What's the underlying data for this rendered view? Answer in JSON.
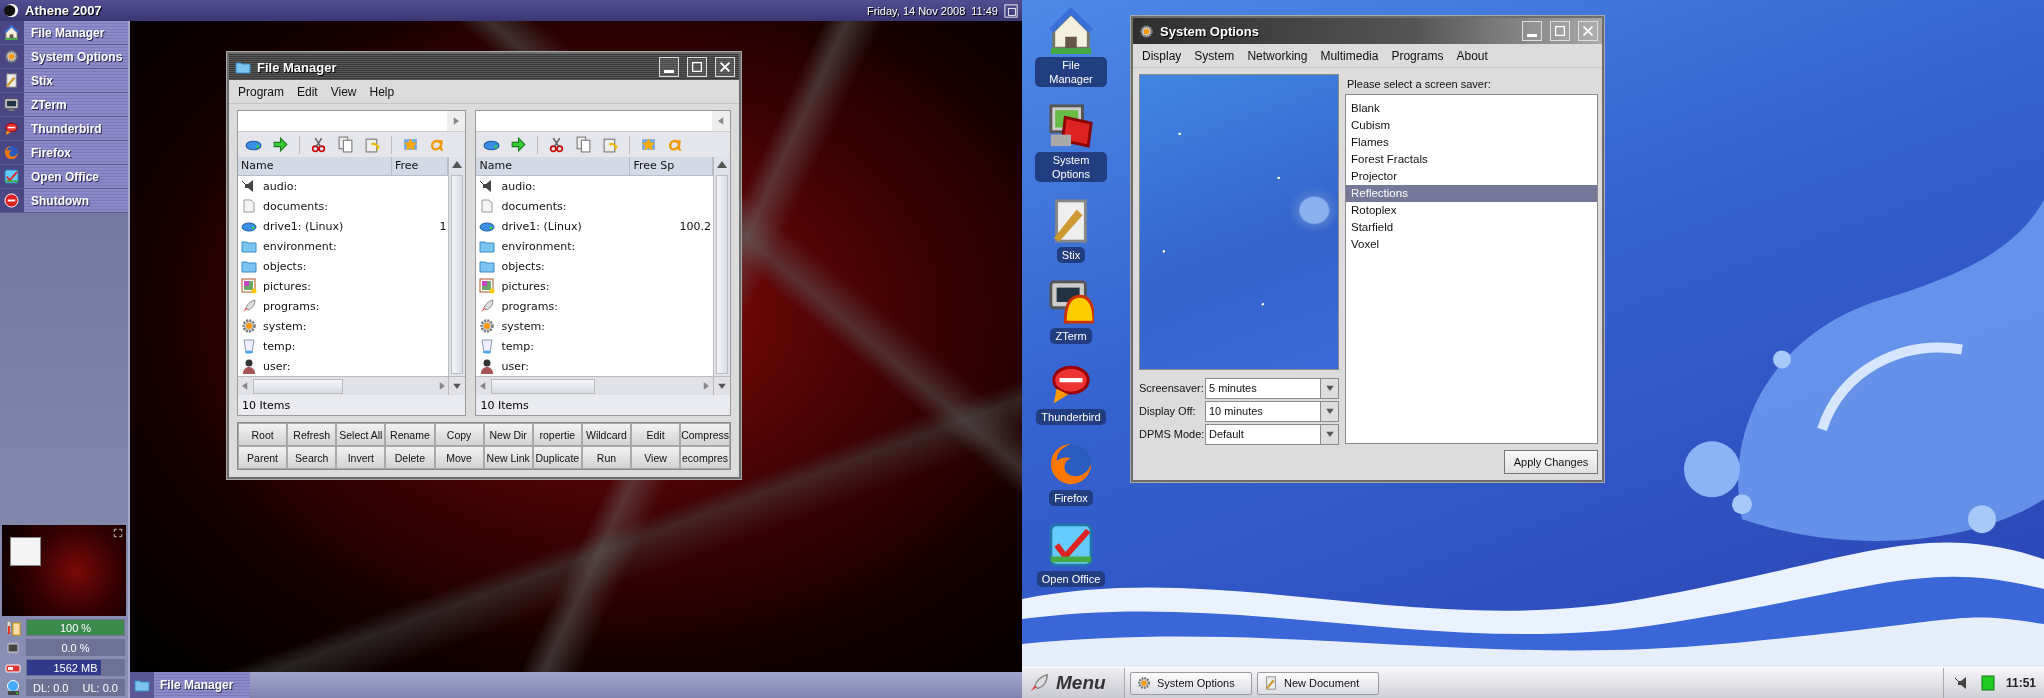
{
  "left_screen": {
    "top_bar": {
      "title": "Athene 2007",
      "date": "Friday, 14 Nov 2008",
      "time": "11:49"
    },
    "sidebar": {
      "items": [
        {
          "label": "File Manager"
        },
        {
          "label": "System Options"
        },
        {
          "label": "Stix"
        },
        {
          "label": "ZTerm"
        },
        {
          "label": "Thunderbird"
        },
        {
          "label": "Firefox"
        },
        {
          "label": "Open Office"
        },
        {
          "label": "Shutdown"
        }
      ],
      "meters": [
        {
          "reading": "100 %",
          "level": 1,
          "color": "#3c8a4c"
        },
        {
          "reading": "0.0 %"
        },
        {
          "reading": "1562 MB",
          "level": 0.76,
          "color": "#303a8a"
        }
      ],
      "network": {
        "download": "DL: 0.0",
        "upload": "UL: 0.0"
      }
    },
    "file_manager": {
      "title": "File Manager",
      "menu": [
        "Program",
        "Edit",
        "View",
        "Help"
      ],
      "panels": [
        {
          "columns": [
            "Name",
            "Free"
          ],
          "rows": [
            {
              "name": "audio:"
            },
            {
              "name": "documents:"
            },
            {
              "name": "drive1: (Linux)",
              "free": "1"
            },
            {
              "name": "environment:"
            },
            {
              "name": "objects:"
            },
            {
              "name": "pictures:"
            },
            {
              "name": "programs:"
            },
            {
              "name": "system:"
            },
            {
              "name": "temp:"
            },
            {
              "name": "user:"
            }
          ],
          "status": "10 Items"
        },
        {
          "columns": [
            "Name",
            "Free Sp"
          ],
          "rows": [
            {
              "name": "audio:"
            },
            {
              "name": "documents:"
            },
            {
              "name": "drive1: (Linux)",
              "free": "100.2"
            },
            {
              "name": "environment:"
            },
            {
              "name": "objects:"
            },
            {
              "name": "pictures:"
            },
            {
              "name": "programs:"
            },
            {
              "name": "system:"
            },
            {
              "name": "temp:"
            },
            {
              "name": "user:"
            }
          ],
          "status": "10 Items"
        }
      ],
      "buttons": [
        [
          "Root",
          "Refresh",
          "Select All",
          "Rename",
          "Copy",
          "New Dir",
          "ropertie",
          "Wildcard",
          "Edit",
          "Compress"
        ],
        [
          "Parent",
          "Search",
          "Invert",
          "Delete",
          "Move",
          "New Link",
          "Duplicate",
          "Run",
          "View",
          "ecompres"
        ]
      ]
    },
    "taskbar": {
      "tasks": [
        "File Manager"
      ]
    }
  },
  "right_screen": {
    "desktop_icons": [
      "File Manager",
      "System Options",
      "Stix",
      "ZTerm",
      "Thunderbird",
      "Firefox",
      "Open Office"
    ],
    "system_options": {
      "title": "System Options",
      "menu": [
        "Display",
        "System",
        "Networking",
        "Multimedia",
        "Programs",
        "About"
      ],
      "prompt": "Please select a screen saver:",
      "screensavers": [
        {
          "label": "Blank",
          "selected": false
        },
        {
          "label": "Cubism",
          "selected": false
        },
        {
          "label": "Flames",
          "selected": false
        },
        {
          "label": "Forest Fractals",
          "selected": false
        },
        {
          "label": "Projector",
          "selected": false
        },
        {
          "label": "Reflections",
          "selected": true
        },
        {
          "label": "Rotoplex",
          "selected": false
        },
        {
          "label": "Starfield",
          "selected": false
        },
        {
          "label": "Voxel",
          "selected": false
        }
      ],
      "settings": [
        {
          "label": "Screensaver:",
          "value": "5 minutes"
        },
        {
          "label": "Display Off:",
          "value": "10 minutes"
        },
        {
          "label": "DPMS Mode:",
          "value": "Default"
        }
      ],
      "apply_button": "Apply Changes"
    },
    "taskbar": {
      "menu_button": "Menu",
      "tasks": [
        "System Options",
        "New Document"
      ],
      "clock": "11:51"
    }
  }
}
